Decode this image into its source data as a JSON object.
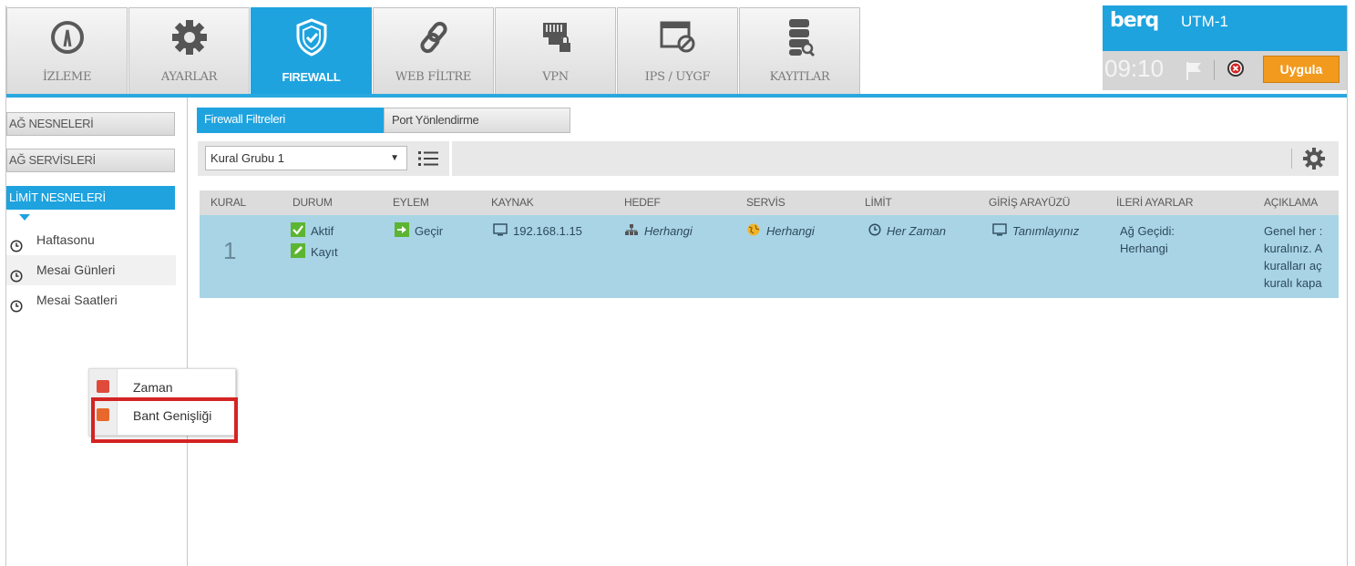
{
  "nav": {
    "items": [
      {
        "label": "İZLEME",
        "icon": "gauge-icon"
      },
      {
        "label": "AYARLAR",
        "icon": "gear-icon"
      },
      {
        "label": "FIREWALL",
        "icon": "shield-icon",
        "active": true
      },
      {
        "label": "WEB FİLTRE",
        "icon": "link-icon"
      },
      {
        "label": "VPN",
        "icon": "network-lock-icon"
      },
      {
        "label": "IPS / UYGF",
        "icon": "window-block-icon"
      },
      {
        "label": "KAYITLAR",
        "icon": "database-search-icon"
      }
    ]
  },
  "brand": {
    "logo": "berq",
    "product": "UTM-1",
    "clock": "09:10",
    "apply_label": "Uygula"
  },
  "sidebar": {
    "headers": [
      "AĞ NESNELERİ",
      "AĞ SERVİSLERİ",
      "LİMİT NESNELERİ"
    ],
    "items": [
      "Haftasonu",
      "Mesai Günleri",
      "Mesai Saatleri"
    ]
  },
  "context_menu": {
    "items": [
      "Zaman",
      "Bant Genişliği"
    ]
  },
  "tabs": [
    "Firewall Filtreleri",
    "Port Yönlendirme"
  ],
  "toolbar": {
    "group_select": "Kural Grubu 1"
  },
  "table": {
    "columns": [
      "KURAL",
      "DURUM",
      "EYLEM",
      "KAYNAK",
      "HEDEF",
      "SERVİS",
      "LİMİT",
      "GİRİŞ ARAYÜZÜ",
      "İLERİ AYARLAR",
      "AÇIKLAMA"
    ],
    "row": {
      "kural": "1",
      "durum_1": "Aktif",
      "durum_2": "Kayıt",
      "eylem": "Geçir",
      "kaynak": "192.168.1.15",
      "hedef": "Herhangi",
      "servis": "Herhangi",
      "limit": "Her Zaman",
      "giris": "Tanımlayınız",
      "ileri_1": "Ağ Geçidi:",
      "ileri_2": "Herhangi",
      "aciklama_1": "Genel her :",
      "aciklama_2": "kuralınız. A",
      "aciklama_3": "kuralları aç",
      "aciklama_4": "kuralı kapa"
    }
  },
  "colors": {
    "accent": "#1ea3df",
    "row_selected": "#a8d4e6",
    "apply": "#f29a1e",
    "highlight": "#d42323"
  }
}
